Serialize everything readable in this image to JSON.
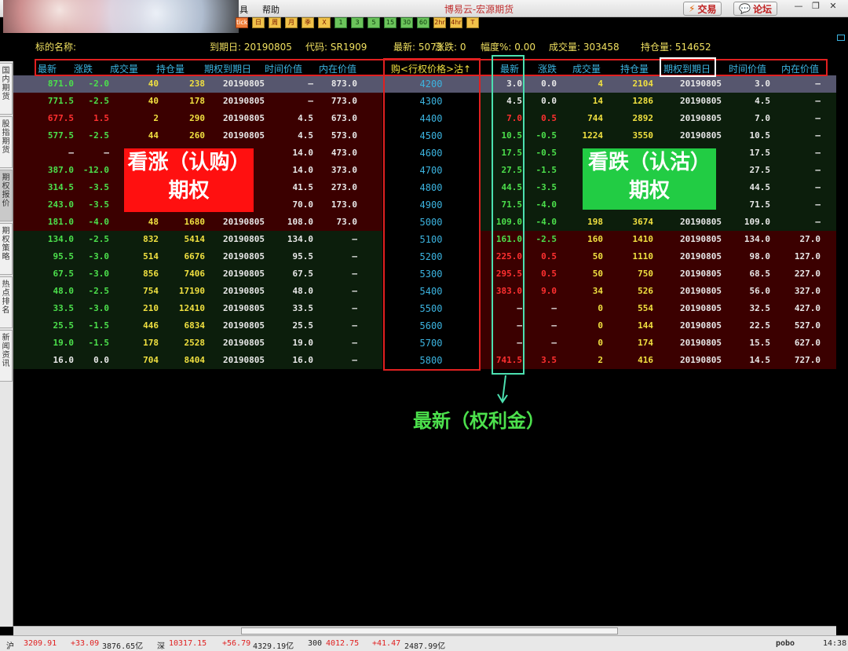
{
  "window": {
    "app_title": "博易云-宏源期货",
    "menu": [
      "具",
      "帮助"
    ],
    "trade_button": "交易",
    "forum_button": "论坛",
    "toolbar_icons": [
      "tick",
      "日",
      "周",
      "月",
      "季",
      "X",
      "1",
      "3",
      "5",
      "15",
      "30",
      "60",
      "2hr",
      "4hr",
      "T"
    ]
  },
  "left_tabs": [
    "国内期货",
    "股指期货",
    "期权报价",
    "期权策略",
    "热点排名",
    "新闻资讯"
  ],
  "info": {
    "underlying_label": "标的名称:",
    "expiry": "到期日: 20190805",
    "code": "代码: SR1909",
    "latest": "最新: 5073",
    "change": "涨跌: 0",
    "pct": "幅度%: 0.00",
    "volume": "成交量: 303458",
    "open_interest": "持仓量: 514652"
  },
  "headers": {
    "call": [
      "最新",
      "涨跌",
      "成交量",
      "持仓量",
      "期权到期日",
      "时间价值",
      "内在价值"
    ],
    "strike": "购<行权价格>沽↑",
    "put": [
      "最新",
      "涨跌",
      "成交量",
      "持仓量",
      "期权到期日",
      "时间价值",
      "内在价值"
    ]
  },
  "rows": [
    {
      "strike": "4200",
      "call": [
        "871.0",
        "-2.0",
        "40",
        "238",
        "20190805",
        "—",
        "873.0"
      ],
      "put": [
        "3.0",
        "0.0",
        "4",
        "2104",
        "20190805",
        "3.0",
        "—"
      ]
    },
    {
      "strike": "4300",
      "call": [
        "771.5",
        "-2.5",
        "40",
        "178",
        "20190805",
        "—",
        "773.0"
      ],
      "put": [
        "4.5",
        "0.0",
        "14",
        "1286",
        "20190805",
        "4.5",
        "—"
      ]
    },
    {
      "strike": "4400",
      "call": [
        "677.5",
        "1.5",
        "2",
        "290",
        "20190805",
        "4.5",
        "673.0"
      ],
      "put": [
        "7.0",
        "0.5",
        "744",
        "2892",
        "20190805",
        "7.0",
        "—"
      ]
    },
    {
      "strike": "4500",
      "call": [
        "577.5",
        "-2.5",
        "44",
        "260",
        "20190805",
        "4.5",
        "573.0"
      ],
      "put": [
        "10.5",
        "-0.5",
        "1224",
        "3550",
        "20190805",
        "10.5",
        "—"
      ]
    },
    {
      "strike": "4600",
      "call": [
        "—",
        "—",
        "",
        "",
        "",
        "14.0",
        "473.0"
      ],
      "put": [
        "17.5",
        "-0.5",
        "",
        "",
        "",
        "17.5",
        "—"
      ]
    },
    {
      "strike": "4700",
      "call": [
        "387.0",
        "-12.0",
        "",
        "",
        "",
        "14.0",
        "373.0"
      ],
      "put": [
        "27.5",
        "-1.5",
        "",
        "",
        "",
        "27.5",
        "—"
      ]
    },
    {
      "strike": "4800",
      "call": [
        "314.5",
        "-3.5",
        "",
        "",
        "",
        "41.5",
        "273.0"
      ],
      "put": [
        "44.5",
        "-3.5",
        "",
        "",
        "",
        "44.5",
        "—"
      ]
    },
    {
      "strike": "4900",
      "call": [
        "243.0",
        "-3.5",
        "",
        "",
        "",
        "70.0",
        "173.0"
      ],
      "put": [
        "71.5",
        "-4.0",
        "",
        "",
        "",
        "71.5",
        "—"
      ]
    },
    {
      "strike": "5000",
      "call": [
        "181.0",
        "-4.0",
        "48",
        "1680",
        "20190805",
        "108.0",
        "73.0"
      ],
      "put": [
        "109.0",
        "-4.0",
        "198",
        "3674",
        "20190805",
        "109.0",
        "—"
      ]
    },
    {
      "strike": "5100",
      "call": [
        "134.0",
        "-2.5",
        "832",
        "5414",
        "20190805",
        "134.0",
        "—"
      ],
      "put": [
        "161.0",
        "-2.5",
        "160",
        "1410",
        "20190805",
        "134.0",
        "27.0"
      ]
    },
    {
      "strike": "5200",
      "call": [
        "95.5",
        "-3.0",
        "514",
        "6676",
        "20190805",
        "95.5",
        "—"
      ],
      "put": [
        "225.0",
        "0.5",
        "50",
        "1110",
        "20190805",
        "98.0",
        "127.0"
      ]
    },
    {
      "strike": "5300",
      "call": [
        "67.5",
        "-3.0",
        "856",
        "7406",
        "20190805",
        "67.5",
        "—"
      ],
      "put": [
        "295.5",
        "0.5",
        "50",
        "750",
        "20190805",
        "68.5",
        "227.0"
      ]
    },
    {
      "strike": "5400",
      "call": [
        "48.0",
        "-2.5",
        "754",
        "17190",
        "20190805",
        "48.0",
        "—"
      ],
      "put": [
        "383.0",
        "9.0",
        "34",
        "526",
        "20190805",
        "56.0",
        "327.0"
      ]
    },
    {
      "strike": "5500",
      "call": [
        "33.5",
        "-3.0",
        "210",
        "12410",
        "20190805",
        "33.5",
        "—"
      ],
      "put": [
        "—",
        "—",
        "0",
        "554",
        "20190805",
        "32.5",
        "427.0"
      ]
    },
    {
      "strike": "5600",
      "call": [
        "25.5",
        "-1.5",
        "446",
        "6834",
        "20190805",
        "25.5",
        "—"
      ],
      "put": [
        "—",
        "—",
        "0",
        "144",
        "20190805",
        "22.5",
        "527.0"
      ]
    },
    {
      "strike": "5700",
      "call": [
        "19.0",
        "-1.5",
        "178",
        "2528",
        "20190805",
        "19.0",
        "—"
      ],
      "put": [
        "—",
        "—",
        "0",
        "174",
        "20190805",
        "15.5",
        "627.0"
      ]
    },
    {
      "strike": "5800",
      "call": [
        "16.0",
        "0.0",
        "704",
        "8404",
        "20190805",
        "16.0",
        "—"
      ],
      "put": [
        "741.5",
        "3.5",
        "2",
        "416",
        "20190805",
        "14.5",
        "727.0"
      ]
    }
  ],
  "annotations": {
    "call_label_line1": "看涨（认购）",
    "call_label_line2": "期权",
    "put_label_line1": "看跌（认沽）",
    "put_label_line2": "期权",
    "premium_note": "最新（权利金）",
    "call_label_color": "#ff1010",
    "put_label_color": "#22cc44"
  },
  "status": {
    "sh_label": "沪",
    "sh_index": "3209.91",
    "sh_change": "+33.09",
    "sh_amount": "3876.65亿",
    "sz_label": "深",
    "sz_index": "10317.15",
    "sz_change": "+56.79",
    "sz_amount": "4329.19亿",
    "i300_label": "300",
    "i300_index": "4012.75",
    "i300_change": "+41.47",
    "i300_amount": "2487.99亿",
    "brand": "pobo",
    "time": "14:38"
  }
}
